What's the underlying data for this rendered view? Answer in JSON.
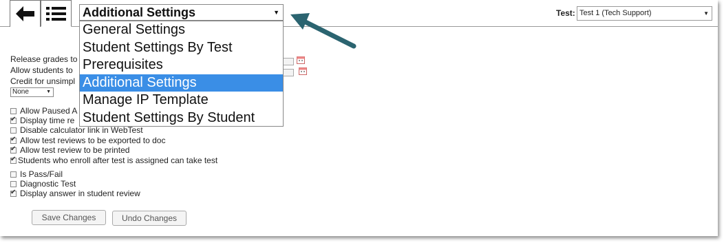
{
  "toolbar": {
    "back_icon": "left-arrow-icon",
    "menu_icon": "list-icon"
  },
  "section_select": {
    "value": "Additional Settings",
    "options": [
      "General Settings",
      "Student Settings By Test",
      "Prerequisites",
      "Additional Settings",
      "Manage IP Template",
      "Student Settings By Student"
    ],
    "selected_index": 3
  },
  "test_select": {
    "label": "Test:",
    "value": "Test 1 (Tech Support)"
  },
  "settings": {
    "release_grades_label": "Release grades to",
    "allow_students_label": "Allow students to",
    "credit_label": "Credit for unsimpl",
    "credit_value": "None",
    "checkboxes_1": [
      {
        "label": "Allow Paused A",
        "checked": false
      },
      {
        "label": "Display time re",
        "checked": true
      },
      {
        "label": "Disable calculator link in WebTest",
        "checked": false
      },
      {
        "label": "Allow test reviews to be exported to doc",
        "checked": true
      },
      {
        "label": "Allow test review to be printed",
        "checked": true
      },
      {
        "label": "Students who enroll after test is assigned can take test",
        "checked": true
      }
    ],
    "checkboxes_2": [
      {
        "label": "Is Pass/Fail",
        "checked": false
      },
      {
        "label": "Diagnostic Test",
        "checked": false
      },
      {
        "label": "Display answer in student review",
        "checked": true
      }
    ]
  },
  "buttons": {
    "save": "Save Changes",
    "undo": "Undo Changes"
  },
  "colors": {
    "annotation_arrow": "#2b6470",
    "selected_option": "#3a8ee6"
  }
}
